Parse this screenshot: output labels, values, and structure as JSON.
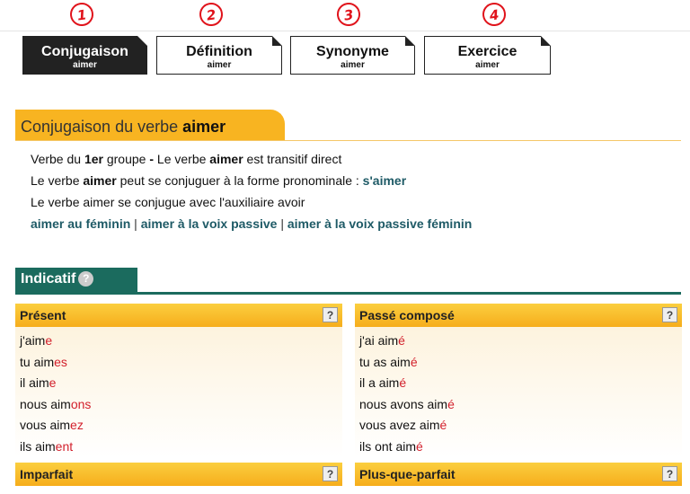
{
  "annotations": [
    "1",
    "2",
    "3",
    "4"
  ],
  "tabs": [
    {
      "title": "Conjugaison",
      "sub": "aimer"
    },
    {
      "title": "Définition",
      "sub": "aimer"
    },
    {
      "title": "Synonyme",
      "sub": "aimer"
    },
    {
      "title": "Exercice",
      "sub": "aimer"
    }
  ],
  "banner": {
    "prefix": "Conjugaison du verbe ",
    "verb": "aimer"
  },
  "info": {
    "line1": {
      "a": "Verbe du ",
      "b": "1er",
      "c": " groupe ",
      "d": "-",
      "e": " Le verbe ",
      "f": "aimer",
      "g": " est transitif direct"
    },
    "line2": {
      "a": "Le verbe ",
      "b": "aimer",
      "c": " peut se conjuguer à la forme pronominale : ",
      "link": "s'aimer"
    },
    "line3": "Le verbe aimer se conjugue avec l'auxiliaire avoir",
    "links": [
      "aimer au féminin",
      "aimer à la voix passive",
      "aimer à la voix passive féminin"
    ],
    "sep": "|"
  },
  "section": {
    "title": "Indicatif",
    "help": "?"
  },
  "panels": {
    "present": {
      "title": "Présent",
      "help": "?",
      "rows": [
        {
          "stem": "j'aim",
          "end": "e"
        },
        {
          "stem": "tu aim",
          "end": "es"
        },
        {
          "stem": "il aim",
          "end": "e"
        },
        {
          "stem": "nous aim",
          "end": "ons"
        },
        {
          "stem": "vous aim",
          "end": "ez"
        },
        {
          "stem": "ils aim",
          "end": "ent"
        }
      ]
    },
    "passe_compose": {
      "title": "Passé composé",
      "help": "?",
      "rows": [
        {
          "stem": "j'ai aim",
          "end": "é"
        },
        {
          "stem": "tu as aim",
          "end": "é"
        },
        {
          "stem": "il a aim",
          "end": "é"
        },
        {
          "stem": "nous avons aim",
          "end": "é"
        },
        {
          "stem": "vous avez aim",
          "end": "é"
        },
        {
          "stem": "ils ont aim",
          "end": "é"
        }
      ]
    },
    "imparfait": {
      "title": "Imparfait",
      "help": "?"
    },
    "plus_que_parfait": {
      "title": "Plus-que-parfait",
      "help": "?"
    }
  },
  "colors": {
    "accent": "#f8b421",
    "section": "#1b6b5e",
    "ending": "#d21f2b",
    "link": "#1e5a66"
  }
}
